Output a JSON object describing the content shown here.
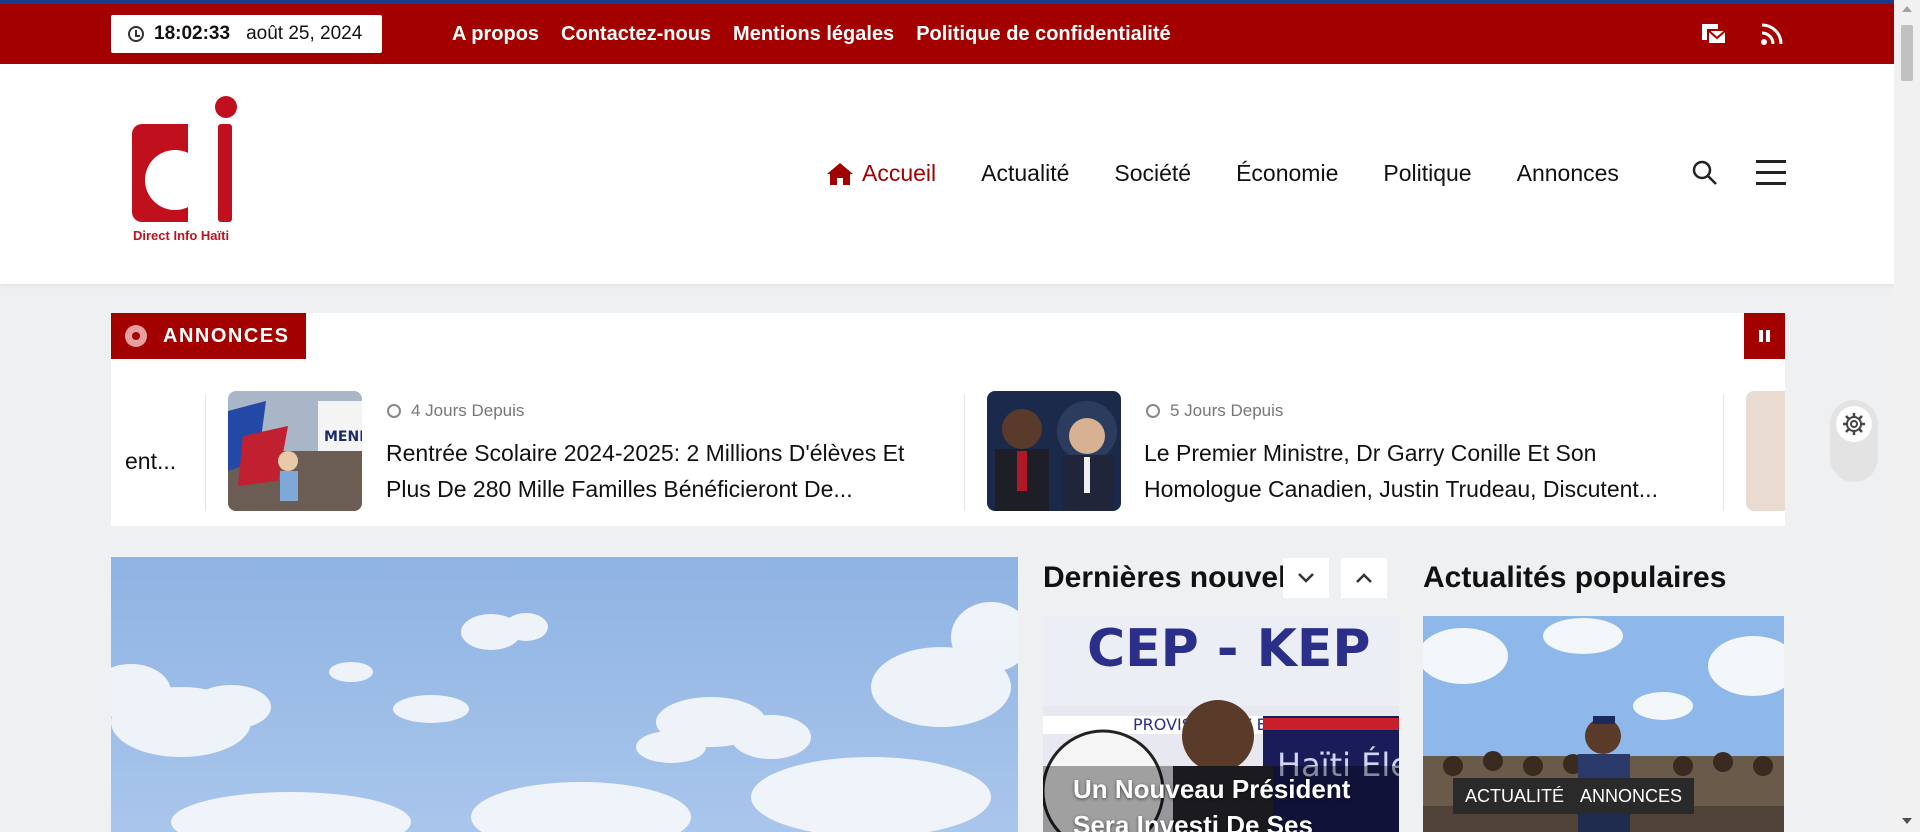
{
  "topbar": {
    "time": "18:02:33",
    "date": "août 25, 2024",
    "links": [
      "A propos",
      "Contactez-nous",
      "Mentions légales",
      "Politique de confidentialité"
    ]
  },
  "header": {
    "logo_text": "Direct Info Haïti",
    "nav": [
      "Accueil",
      "Actualité",
      "Société",
      "Économie",
      "Politique",
      "Annonces"
    ]
  },
  "ticker": {
    "label": "ANNONCES",
    "fragment": "ent...",
    "items": [
      {
        "time": "4 Jours Depuis",
        "title": "Rentrée Scolaire 2024-2025: 2 Millions D'élèves Et Plus De 280 Mille Familles Bénéficieront De..."
      },
      {
        "time": "5 Jours Depuis",
        "title": "Le Premier Ministre, Dr Garry Conille Et Son Homologue Canadien, Justin Trudeau, Discutent..."
      }
    ]
  },
  "latest": {
    "title": "Dernières nouvelles",
    "card_title": "Un Nouveau Président Sera Investi De Ses"
  },
  "popular": {
    "title": "Actualités populaires",
    "tags": [
      "ACTUALITÉ",
      "ANNONCES"
    ]
  },
  "colors": {
    "brand": "#a30000",
    "accent_blue": "#1a3a8a"
  }
}
